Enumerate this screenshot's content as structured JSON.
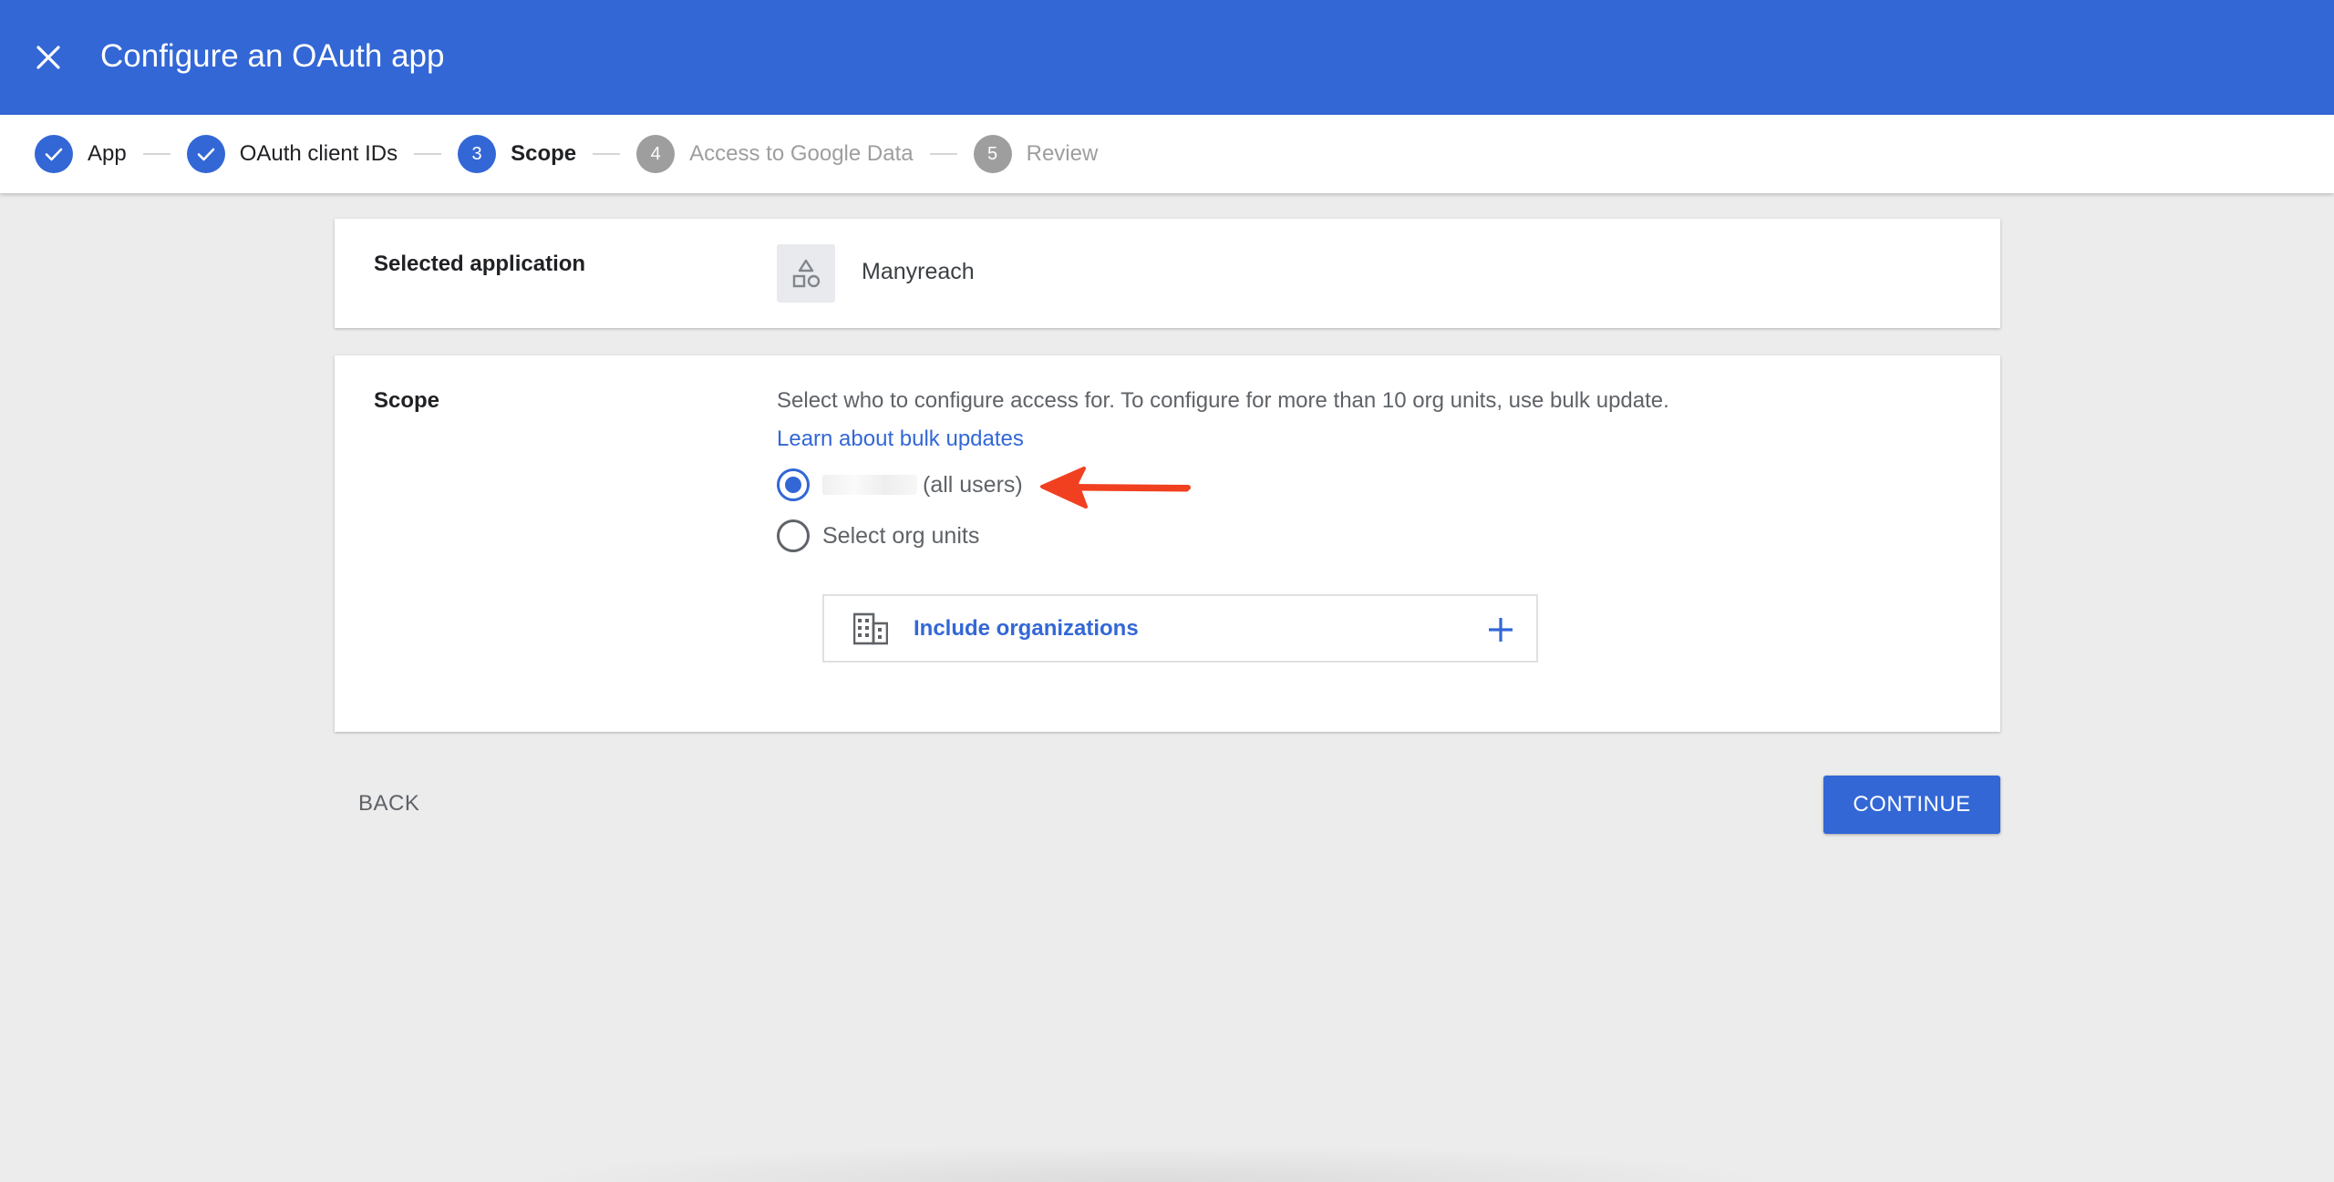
{
  "header": {
    "title": "Configure an OAuth app",
    "close_icon": "close-icon"
  },
  "stepper": {
    "steps": [
      {
        "number": "1",
        "label": "App",
        "state": "done"
      },
      {
        "number": "2",
        "label": "OAuth client IDs",
        "state": "done"
      },
      {
        "number": "3",
        "label": "Scope",
        "state": "active"
      },
      {
        "number": "4",
        "label": "Access to Google Data",
        "state": "todo"
      },
      {
        "number": "5",
        "label": "Review",
        "state": "todo"
      }
    ]
  },
  "selected_app": {
    "label": "Selected application",
    "icon": "shapes-icon",
    "name": "Manyreach"
  },
  "scope": {
    "label": "Scope",
    "description": "Select who to configure access for. To configure for more than 10 org units, use bulk update.",
    "bulk_link": "Learn about bulk updates",
    "option_all_suffix": "(all users)",
    "option_all_selected": true,
    "option_org": "Select org units",
    "include_label": "Include organizations"
  },
  "footer": {
    "back_label": "BACK",
    "continue_label": "CONTINUE"
  },
  "colors": {
    "brand": "#3367d6",
    "annotation": "#f04020"
  }
}
